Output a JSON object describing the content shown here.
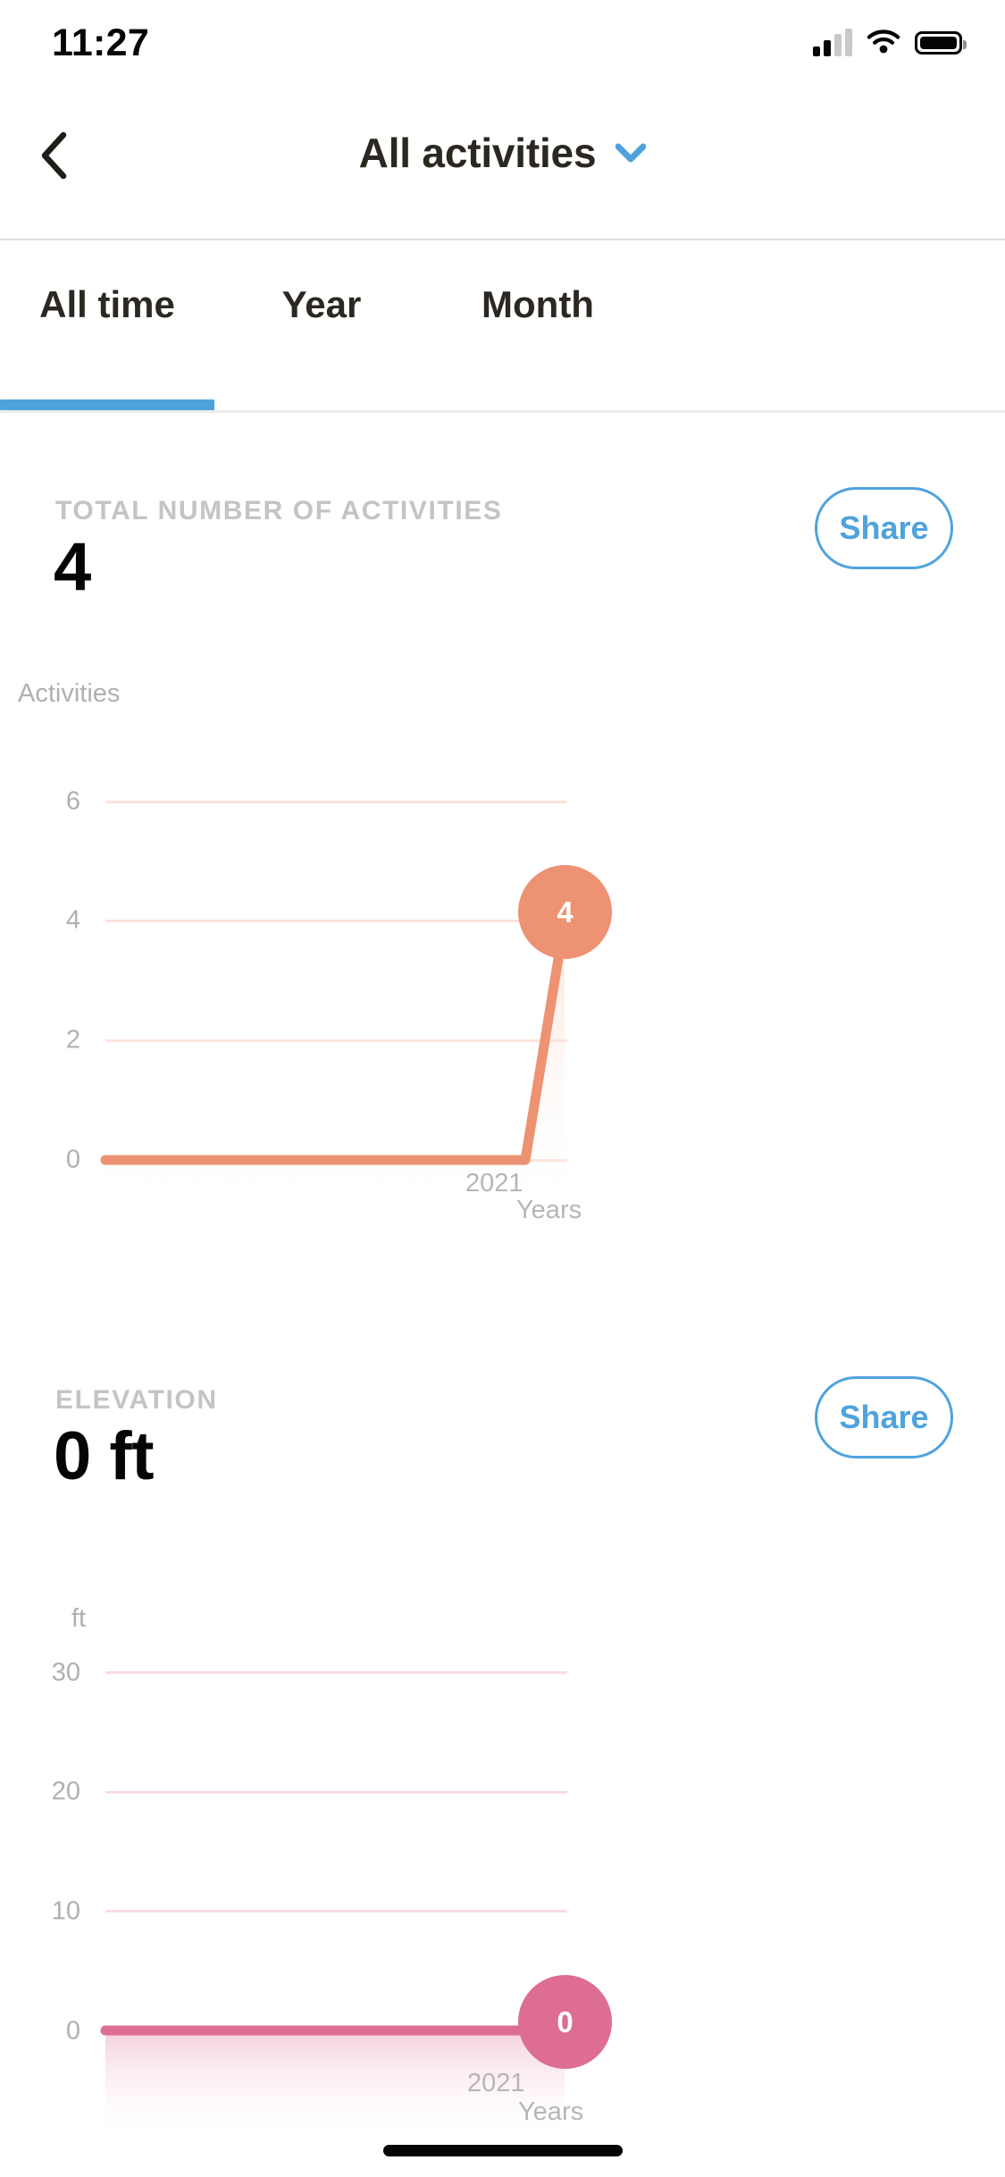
{
  "status_bar": {
    "time": "11:27",
    "icons": [
      "cellular-signal-icon",
      "wifi-icon",
      "battery-icon"
    ]
  },
  "header": {
    "back_icon": "chevron-left-icon",
    "title": "All activities",
    "dropdown_icon": "chevron-down-icon",
    "dropdown_color": "#4fa3dd"
  },
  "tabs": {
    "items": [
      {
        "label": "All time",
        "active": true
      },
      {
        "label": "Year",
        "active": false
      },
      {
        "label": "Month",
        "active": false
      }
    ],
    "active_indicator_color": "#4fa3dd"
  },
  "sections": [
    {
      "label": "TOTAL NUMBER OF ACTIVITIES",
      "value": "4",
      "share_label": "Share",
      "accent_color": "#ed9272"
    },
    {
      "label": "ELEVATION",
      "value": "0 ft",
      "share_label": "Share",
      "accent_color": "#dd6d95"
    }
  ],
  "chart_data": [
    {
      "type": "line",
      "title": "TOTAL NUMBER OF ACTIVITIES",
      "ylabel": "Activities",
      "xlabel": "Years",
      "categories": [
        "",
        "2021"
      ],
      "x": [
        "",
        "2021"
      ],
      "values": [
        0,
        4
      ],
      "yticks": [
        6,
        4,
        2,
        0
      ],
      "ylim": [
        0,
        6
      ],
      "xticks": [
        "2021"
      ],
      "point_label": "4",
      "line_color": "#ed9272",
      "grid_color": "#fbe4da",
      "fill_color": "#fdf1ec",
      "marker_color": "#ed9272",
      "grid": true,
      "legend": "none"
    },
    {
      "type": "line",
      "title": "ELEVATION",
      "ylabel": "ft",
      "xlabel": "Years",
      "categories": [
        "",
        "2021"
      ],
      "x": [
        "",
        "2021"
      ],
      "values": [
        0,
        0
      ],
      "yticks": [
        30,
        20,
        10,
        0
      ],
      "ylim": [
        0,
        30
      ],
      "xticks": [
        "2021"
      ],
      "point_label": "0",
      "line_color": "#dd6d95",
      "grid_color": "#f7dce6",
      "fill_color": "#fbe9f0",
      "marker_color": "#dd6d95",
      "grid": true,
      "legend": "none"
    }
  ]
}
